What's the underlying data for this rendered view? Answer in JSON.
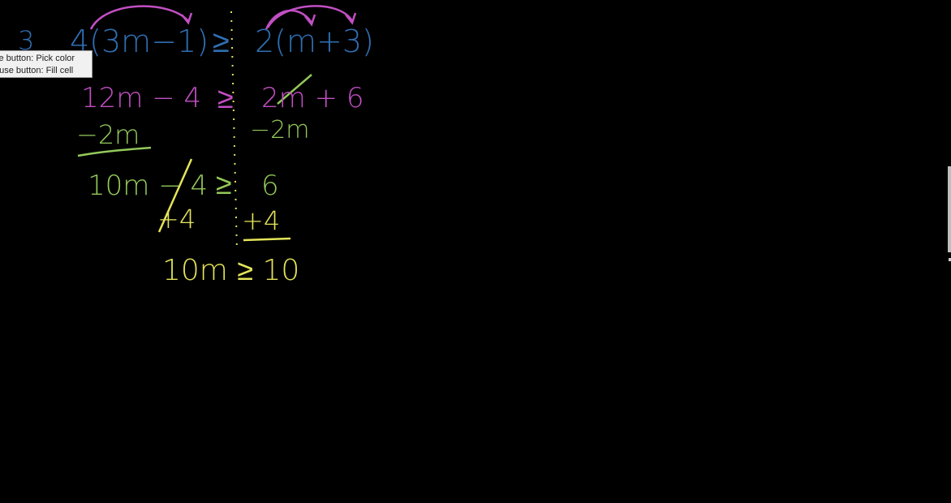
{
  "tooltip": {
    "line1": "se button: Pick color",
    "line2": "ouse button: Fill cell"
  },
  "blackboard": {
    "problem_number": "3",
    "line1_left": "4(3m−1)",
    "line1_op": "≥",
    "line1_right": "2(m+3)",
    "line2_left": "12m − 4",
    "line2_op": "≥",
    "line2_right": "2m + 6",
    "line3_left": "−2m",
    "line3_right": "−2m",
    "line4_left": "10m − 4",
    "line4_op": "≥",
    "line4_right": "6",
    "line5_left": "+4",
    "line5_right": "+4",
    "line6": "10m ≥ 10"
  },
  "colors": {
    "background": "#000000",
    "blue": "#2f6fb3",
    "pink": "#c24fc4",
    "green": "#93c95a",
    "yellow": "#e4e45a"
  }
}
